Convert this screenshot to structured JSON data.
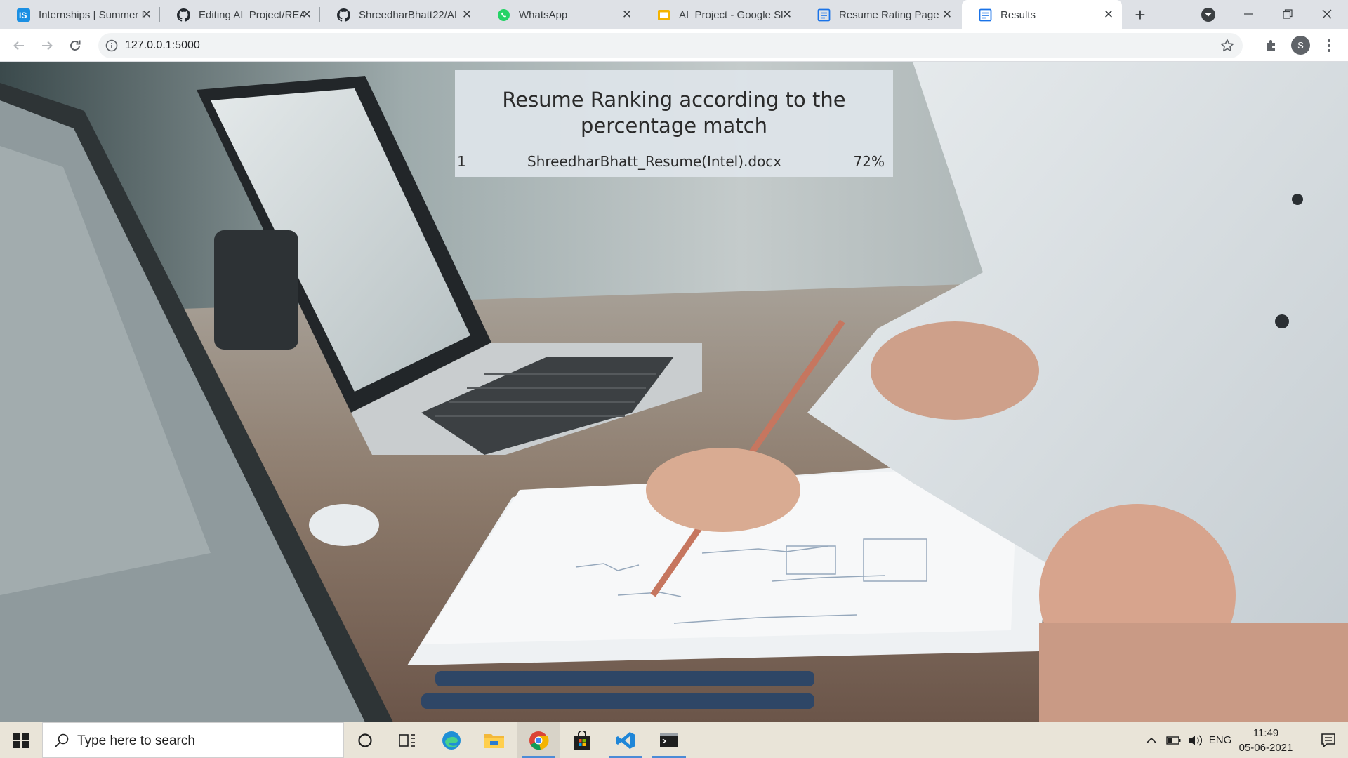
{
  "browser": {
    "tabs": [
      {
        "title": "Internships | Summer I",
        "icon": "internshala-icon",
        "active": false
      },
      {
        "title": "Editing AI_Project/REA",
        "icon": "github-icon",
        "active": false
      },
      {
        "title": "ShreedharBhatt22/AI_",
        "icon": "github-icon",
        "active": false
      },
      {
        "title": "WhatsApp",
        "icon": "whatsapp-icon",
        "active": false
      },
      {
        "title": "AI_Project - Google Sl",
        "icon": "google-slides-icon",
        "active": false
      },
      {
        "title": "Resume Rating Page",
        "icon": "page-icon",
        "active": false
      },
      {
        "title": "Results",
        "icon": "page-icon",
        "active": true
      }
    ],
    "address": "127.0.0.1:5000",
    "profile_initial": "S"
  },
  "page": {
    "title": "Resume Ranking according to the percentage match",
    "results": [
      {
        "rank": "1",
        "file": "ShreedharBhatt_Resume(Intel).docx",
        "match": "72%"
      }
    ]
  },
  "taskbar": {
    "search_placeholder": "Type here to search",
    "language": "ENG",
    "time": "11:49",
    "date": "05-06-2021",
    "apps": [
      "cortana-icon",
      "task-view-icon",
      "edge-icon",
      "file-explorer-icon",
      "chrome-icon",
      "store-icon",
      "vscode-icon",
      "terminal-icon"
    ]
  },
  "colors": {
    "tabstrip": "#dee1e6",
    "card": "#dee4e9",
    "taskbar": "#e9e4d8",
    "accent": "#4c8bd6"
  }
}
